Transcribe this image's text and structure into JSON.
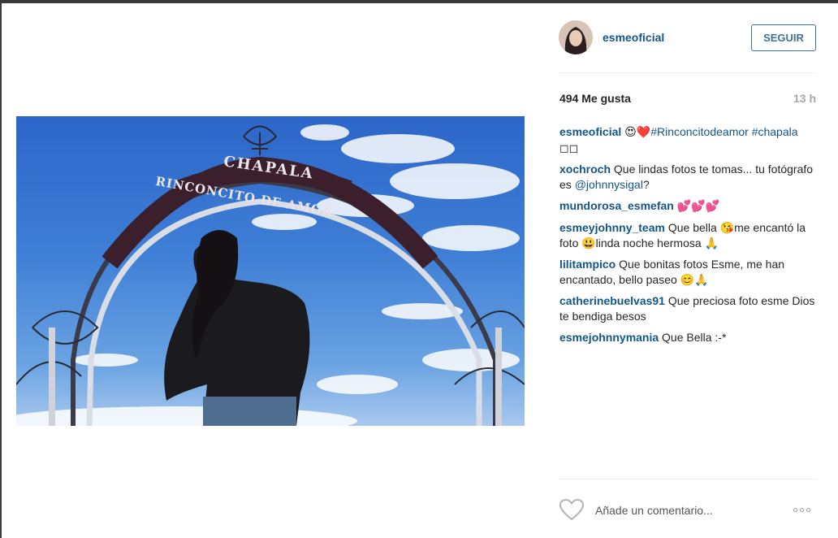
{
  "post": {
    "username": "esmeoficial",
    "follow_label": "SEGUIR",
    "likes_count": "494",
    "likes_word": "Me gusta",
    "time_ago": "13 h",
    "caption": {
      "user": "esmeoficial",
      "emoji": "😍❤️",
      "text": "#Rinconcitodeamor #chapala",
      "trailing_glyphs": "◻◻"
    }
  },
  "comments": [
    {
      "user": "xochroch",
      "text": "Que lindas fotos te tomas... tu fotógrafo es ",
      "mention": "@johnnysigal",
      "after": "?"
    },
    {
      "user": "mundorosa_esmefan",
      "text": "💕💕💕",
      "mention": "",
      "after": ""
    },
    {
      "user": "esmeyjohnny_team",
      "text": "Que bella 😘me encantó la foto 😃linda noche hermosa 🙏",
      "mention": "",
      "after": ""
    },
    {
      "user": "lilitampico",
      "text": "Que bonitas fotos Esme, me han encantado, bello paseo 😊🙏",
      "mention": "",
      "after": ""
    },
    {
      "user": "catherinebuelvas91",
      "text": "Que preciosa foto esme Dios te bendiga besos",
      "mention": "",
      "after": ""
    },
    {
      "user": "esmejohnnymania",
      "text": "Que Bella :-*",
      "mention": "",
      "after": ""
    }
  ],
  "photo": {
    "arch_top_text": "CHAPALA",
    "arch_text": "RINCONCITO DE AMOR"
  },
  "add_comment": {
    "placeholder": "Añade un comentario..."
  },
  "icons": {
    "like": "heart-outline-icon",
    "more": "more-options-icon"
  },
  "colors": {
    "link": "#125688",
    "follow_border": "#3f729b",
    "muted": "#a5a7aa"
  }
}
